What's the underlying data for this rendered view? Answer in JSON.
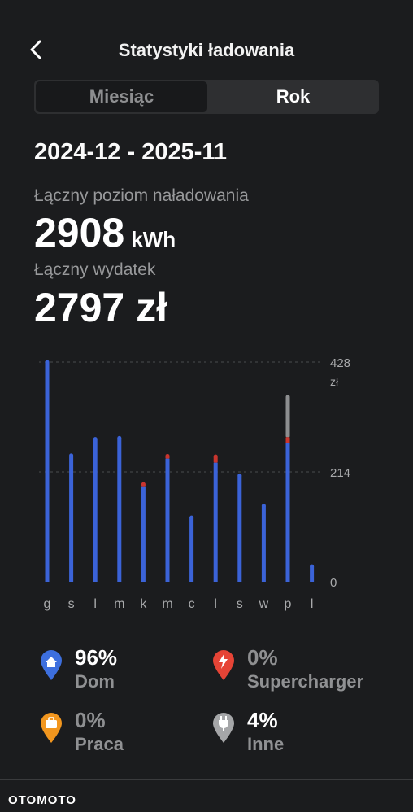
{
  "header": {
    "title": "Statystyki ładowania"
  },
  "tabs": [
    {
      "label": "Miesiąc",
      "selected": false
    },
    {
      "label": "Rok",
      "selected": true
    }
  ],
  "range": "2024-12 - 2025-11",
  "totals": {
    "energy_label": "Łączny poziom naładowania",
    "energy_value": "2908",
    "energy_unit": "kWh",
    "cost_label": "Łączny wydatek",
    "cost_value": "2797 zł"
  },
  "chart_data": {
    "type": "bar",
    "categories": [
      "g",
      "s",
      "l",
      "m",
      "k",
      "m",
      "c",
      "l",
      "s",
      "w",
      "p",
      "l"
    ],
    "series": [
      {
        "values": [
          428,
          246,
          278,
          280,
          186,
          240,
          125,
          232,
          207,
          148,
          270,
          30
        ]
      },
      {
        "values": [
          0,
          0,
          0,
          0,
          4,
          5,
          0,
          12,
          0,
          0,
          12,
          0
        ]
      },
      {
        "values": [
          0,
          0,
          0,
          0,
          0,
          0,
          0,
          0,
          0,
          0,
          78,
          0
        ]
      }
    ],
    "colors": [
      "#3b63d8",
      "#c9352e",
      "#8d8e90"
    ],
    "yticks": [
      "428",
      "214",
      "0"
    ],
    "yunit": "zł",
    "ylim": [
      0,
      428
    ],
    "grid": true
  },
  "legend": [
    {
      "pct": "96%",
      "name": "Dom",
      "icon": "home-icon",
      "color": "#3d6fde",
      "active": true
    },
    {
      "pct": "0%",
      "name": "Supercharger",
      "icon": "bolt-icon",
      "color": "#e64436",
      "active": false
    },
    {
      "pct": "0%",
      "name": "Praca",
      "icon": "briefcase-icon",
      "color": "#f2961e",
      "active": false
    },
    {
      "pct": "4%",
      "name": "Inne",
      "icon": "plug-icon",
      "color": "#a5a6a8",
      "active": true
    }
  ],
  "footer": {
    "brand": "OTOMOTO"
  }
}
